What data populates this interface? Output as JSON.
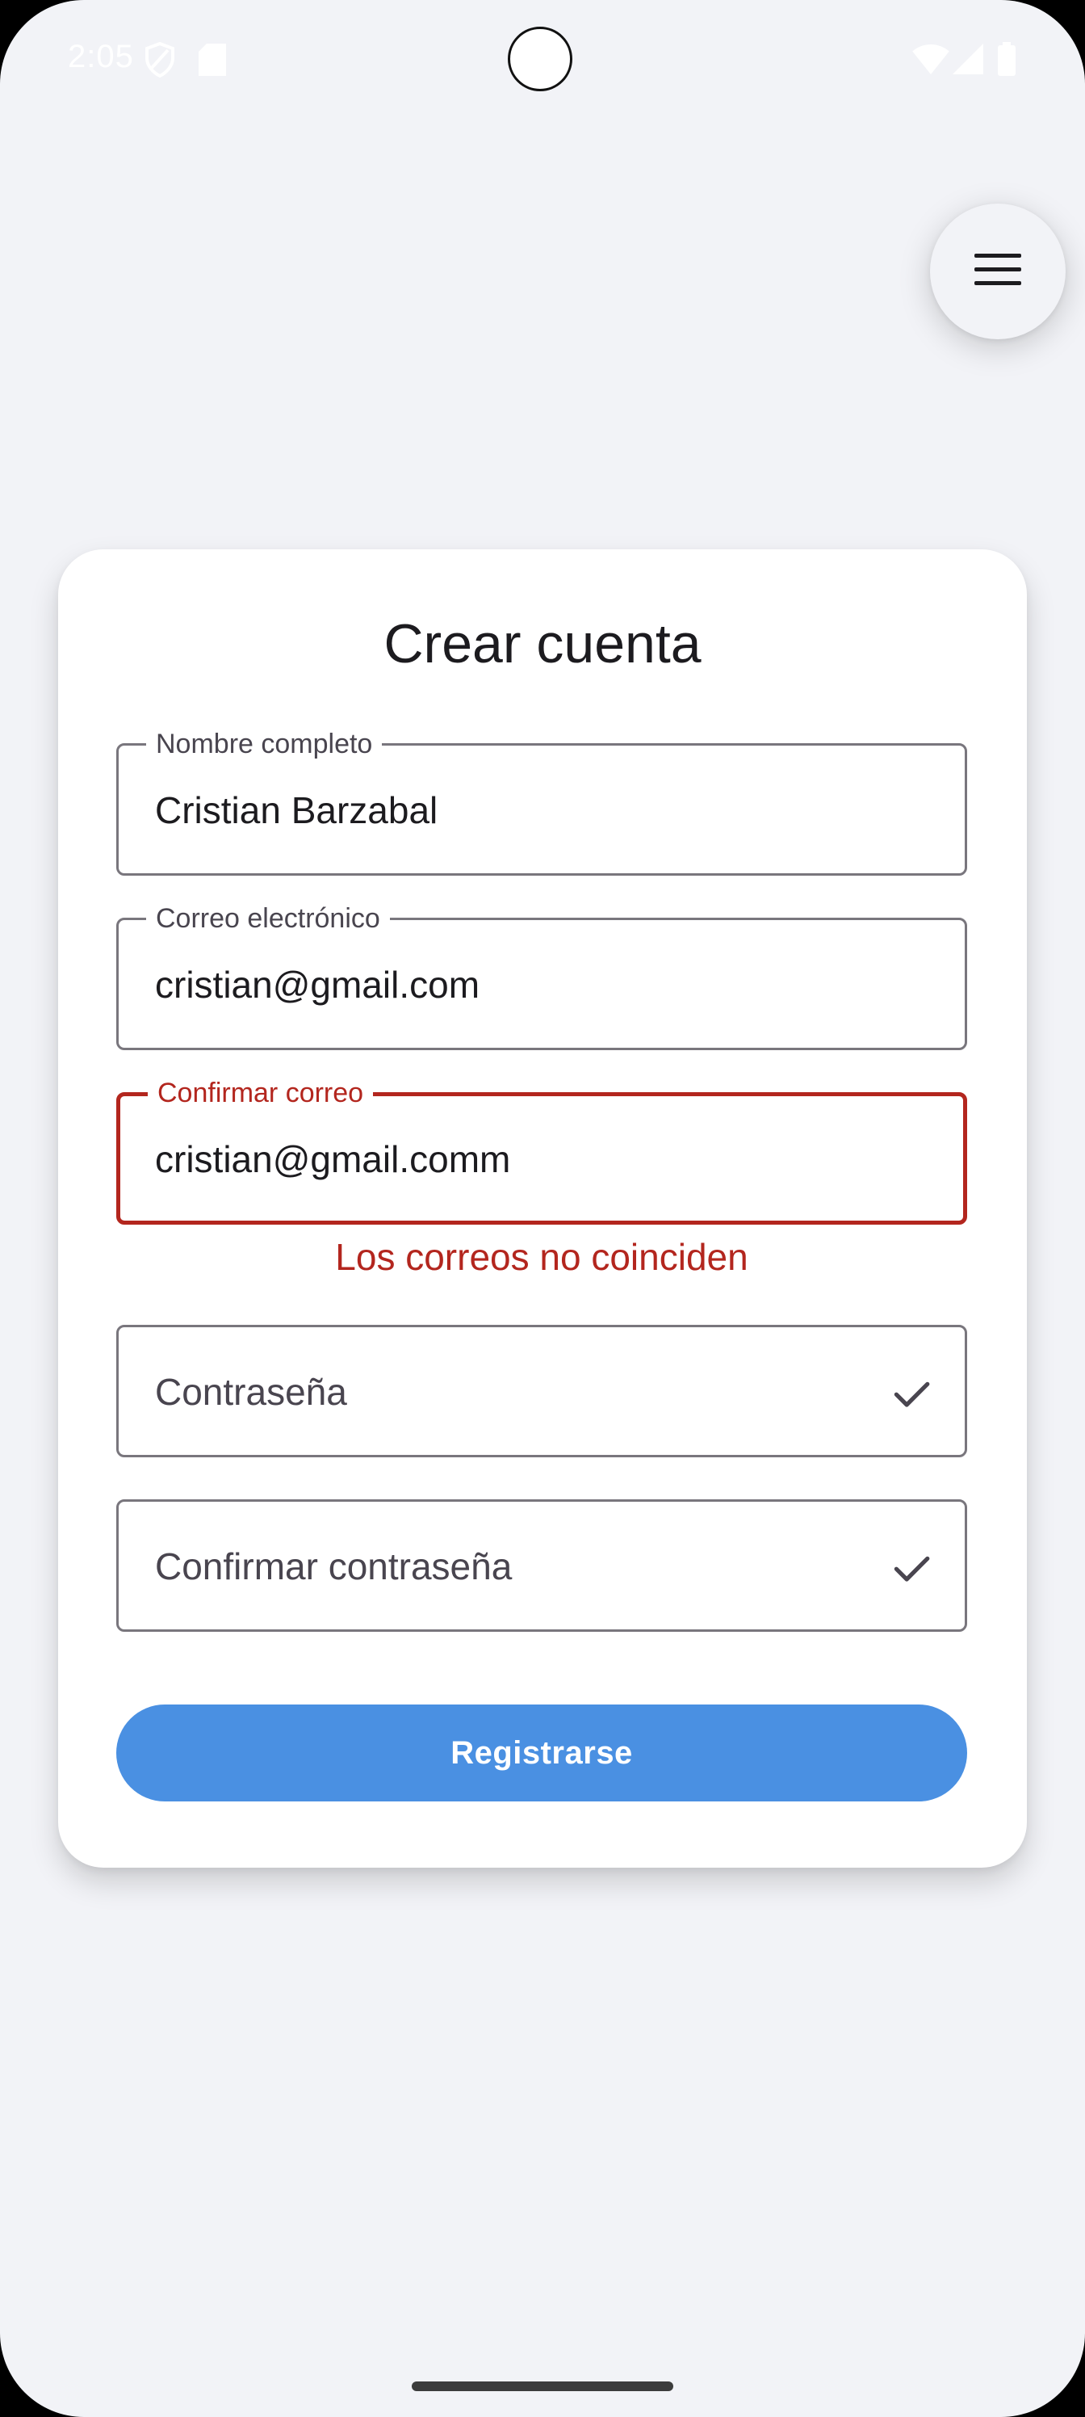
{
  "status_bar": {
    "time": "2:05",
    "icons": [
      "shield-icon",
      "sd-card-icon",
      "wifi-icon",
      "signal-icon",
      "battery-icon"
    ]
  },
  "menu_button": {
    "icon": "hamburger-menu-icon"
  },
  "form": {
    "title": "Crear cuenta",
    "fields": [
      {
        "label": "Nombre completo",
        "value": "Cristian Barzabal"
      },
      {
        "label": "Correo electrónico",
        "value": "cristian@gmail.com"
      },
      {
        "label": "Confirmar correo",
        "value": "cristian@gmail.comm",
        "error": true
      }
    ],
    "error_message": "Los correos no coinciden",
    "password_fields": [
      {
        "placeholder": "Contraseña",
        "trailing_icon": "check-icon"
      },
      {
        "placeholder": "Confirmar contraseña",
        "trailing_icon": "check-icon"
      }
    ],
    "submit_label": "Registrarse"
  },
  "colors": {
    "background": "#f2f3f7",
    "primary_button": "#4a90e2",
    "error": "#b3261e",
    "outline": "#79767d"
  }
}
